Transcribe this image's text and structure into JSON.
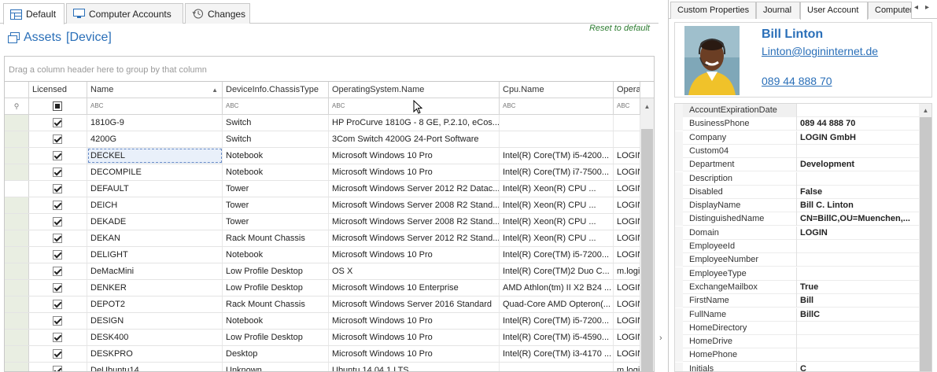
{
  "left_tabs": {
    "default": "Default",
    "computer_accounts": "Computer Accounts",
    "changes": "Changes"
  },
  "header": {
    "title": "Assets",
    "context": "[Device]",
    "reset": "Reset to default"
  },
  "group_panel_text": "Drag a column header here to group by that column",
  "grid": {
    "columns": [
      "Licensed",
      "Name",
      "DeviceInfo.ChassisType",
      "OperatingSystem.Name",
      "Cpu.Name",
      "Operating"
    ],
    "filter_glyph": "ABC",
    "rows": [
      {
        "licensed": true,
        "name": "1810G-9",
        "chassis": "Switch",
        "os": "HP ProCurve 1810G - 8 GE, P.2.10, eCos...",
        "cpu": "",
        "op": ""
      },
      {
        "licensed": true,
        "name": "4200G",
        "chassis": "Switch",
        "os": "3Com Switch 4200G 24-Port Software",
        "cpu": "",
        "op": ""
      },
      {
        "licensed": true,
        "name": "DECKEL",
        "chassis": "Notebook",
        "os": "Microsoft Windows 10 Pro",
        "cpu": "Intel(R) Core(TM) i5-4200...",
        "op": "LOGIN"
      },
      {
        "licensed": true,
        "name": "DECOMPILE",
        "chassis": "Notebook",
        "os": "Microsoft Windows 10 Pro",
        "cpu": "Intel(R) Core(TM) i7-7500...",
        "op": "LOGIN"
      },
      {
        "licensed": true,
        "name": "DEFAULT",
        "chassis": "Tower",
        "os": "Microsoft Windows Server 2012 R2 Datac...",
        "cpu": "Intel(R) Xeon(R) CPU       ...",
        "op": "LOGIN"
      },
      {
        "licensed": true,
        "name": "DEICH",
        "chassis": "Tower",
        "os": "Microsoft Windows Server 2008 R2 Stand...",
        "cpu": "Intel(R) Xeon(R) CPU       ...",
        "op": "LOGIN"
      },
      {
        "licensed": true,
        "name": "DEKADE",
        "chassis": "Tower",
        "os": "Microsoft Windows Server 2008 R2 Stand...",
        "cpu": "Intel(R) Xeon(R) CPU       ...",
        "op": "LOGIN"
      },
      {
        "licensed": true,
        "name": "DEKAN",
        "chassis": "Rack Mount Chassis",
        "os": "Microsoft Windows Server 2012 R2 Stand...",
        "cpu": "Intel(R) Xeon(R) CPU       ...",
        "op": "LOGIN"
      },
      {
        "licensed": true,
        "name": "DELIGHT",
        "chassis": "Notebook",
        "os": "Microsoft Windows 10 Pro",
        "cpu": "Intel(R) Core(TM) i5-7200...",
        "op": "LOGIN"
      },
      {
        "licensed": true,
        "name": "DeMacMini",
        "chassis": "Low Profile Desktop",
        "os": "OS X",
        "cpu": "Intel(R) Core(TM)2 Duo C...",
        "op": "m.login"
      },
      {
        "licensed": true,
        "name": "DENKER",
        "chassis": "Low Profile Desktop",
        "os": "Microsoft Windows 10 Enterprise",
        "cpu": "AMD Athlon(tm) II X2 B24 ...",
        "op": "LOGIN"
      },
      {
        "licensed": true,
        "name": "DEPOT2",
        "chassis": "Rack Mount Chassis",
        "os": "Microsoft Windows Server 2016 Standard",
        "cpu": "Quad-Core AMD Opteron(...",
        "op": "LOGIN"
      },
      {
        "licensed": true,
        "name": "DESIGN",
        "chassis": "Notebook",
        "os": "Microsoft Windows 10 Pro",
        "cpu": "Intel(R) Core(TM) i5-7200...",
        "op": "LOGIN"
      },
      {
        "licensed": true,
        "name": "DESK400",
        "chassis": "Low Profile Desktop",
        "os": "Microsoft Windows 10 Pro",
        "cpu": "Intel(R) Core(TM) i5-4590...",
        "op": "LOGIN"
      },
      {
        "licensed": true,
        "name": "DESKPRO",
        "chassis": "Desktop",
        "os": "Microsoft Windows 10 Pro",
        "cpu": "Intel(R) Core(TM) i3-4170 ...",
        "op": "LOGIN"
      },
      {
        "licensed": true,
        "name": "DeUbuntu14",
        "chassis": "Unknown",
        "os": "Ubuntu 14.04.1 LTS",
        "cpu": "",
        "op": "m.login"
      }
    ]
  },
  "right_tabs": [
    "Custom Properties",
    "Journal",
    "User Account",
    "Computer"
  ],
  "user": {
    "name": "Bill Linton",
    "email": "Linton@logininternet.de",
    "phone": "089 44 888 70"
  },
  "properties": [
    {
      "name": "AccountExpirationDate",
      "value": ""
    },
    {
      "name": "BusinessPhone",
      "value": "089 44 888 70"
    },
    {
      "name": "Company",
      "value": "LOGIN GmbH"
    },
    {
      "name": "Custom04",
      "value": ""
    },
    {
      "name": "Department",
      "value": "Development"
    },
    {
      "name": "Description",
      "value": ""
    },
    {
      "name": "Disabled",
      "value": "False"
    },
    {
      "name": "DisplayName",
      "value": "Bill C. Linton"
    },
    {
      "name": "DistinguishedName",
      "value": "CN=BillC,OU=Muenchen,..."
    },
    {
      "name": "Domain",
      "value": "LOGIN"
    },
    {
      "name": "EmployeeId",
      "value": ""
    },
    {
      "name": "EmployeeNumber",
      "value": ""
    },
    {
      "name": "EmployeeType",
      "value": ""
    },
    {
      "name": "ExchangeMailbox",
      "value": "True"
    },
    {
      "name": "FirstName",
      "value": "Bill"
    },
    {
      "name": "FullName",
      "value": "BillC"
    },
    {
      "name": "HomeDirectory",
      "value": ""
    },
    {
      "name": "HomeDrive",
      "value": ""
    },
    {
      "name": "HomePhone",
      "value": ""
    },
    {
      "name": "Initials",
      "value": "C"
    }
  ],
  "colors": {
    "accent": "#2a6fb8",
    "reset_green": "#2e7d32",
    "indicator": "#e9eee2"
  }
}
